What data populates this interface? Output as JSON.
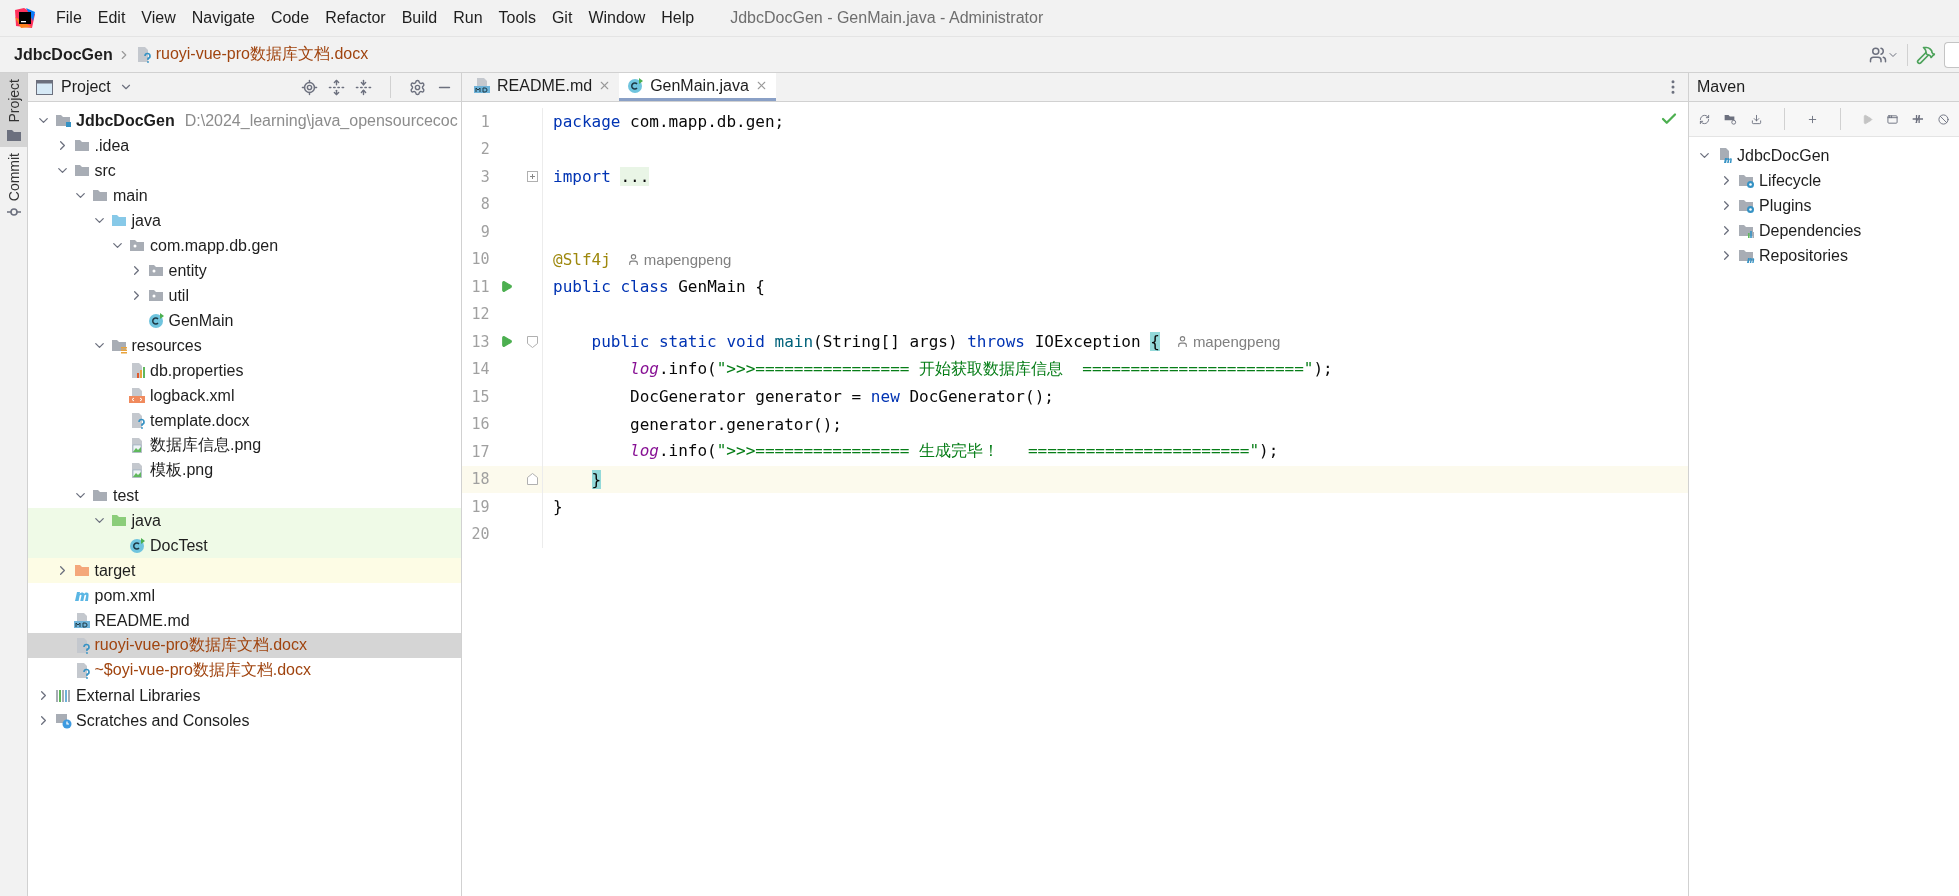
{
  "menu_bar": {
    "menus": [
      "File",
      "Edit",
      "View",
      "Navigate",
      "Code",
      "Refactor",
      "Build",
      "Run",
      "Tools",
      "Git",
      "Window",
      "Help"
    ],
    "title": "JdbcDocGen - GenMain.java - Administrator"
  },
  "breadcrumb": {
    "project": "JdbcDocGen",
    "file": "ruoyi-vue-pro数据库文档.docx"
  },
  "side_strip": {
    "tabs": [
      {
        "label": "Project",
        "selected": true
      },
      {
        "label": "Commit",
        "selected": false
      }
    ]
  },
  "project_panel": {
    "title": "Project",
    "tree": [
      {
        "label": "JdbcDocGen",
        "path": "D:\\2024_learning\\java_opensourcecoc",
        "kind": "module",
        "expanded": true,
        "selected": false,
        "children": [
          {
            "label": ".idea",
            "kind": "folder",
            "expanded": false,
            "selected": false
          },
          {
            "label": "src",
            "kind": "folder",
            "expanded": true,
            "selected": false,
            "children": [
              {
                "label": "main",
                "kind": "folder",
                "expanded": true,
                "selected": false,
                "children": [
                  {
                    "label": "java",
                    "kind": "source-folder",
                    "expanded": true,
                    "selected": false,
                    "children": [
                      {
                        "label": "com.mapp.db.gen",
                        "kind": "package",
                        "expanded": true,
                        "selected": false,
                        "children": [
                          {
                            "label": "entity",
                            "kind": "package",
                            "expanded": false,
                            "selected": false
                          },
                          {
                            "label": "util",
                            "kind": "package",
                            "expanded": false,
                            "selected": false
                          },
                          {
                            "label": "GenMain",
                            "kind": "class",
                            "selected": false
                          }
                        ]
                      }
                    ]
                  },
                  {
                    "label": "resources",
                    "kind": "resources",
                    "expanded": true,
                    "selected": false,
                    "children": [
                      {
                        "label": "db.properties",
                        "kind": "properties",
                        "selected": false
                      },
                      {
                        "label": "logback.xml",
                        "kind": "xml",
                        "selected": false
                      },
                      {
                        "label": "template.docx",
                        "kind": "doc",
                        "selected": false
                      },
                      {
                        "label": "数据库信息.png",
                        "kind": "image",
                        "selected": false
                      },
                      {
                        "label": "模板.png",
                        "kind": "image",
                        "selected": false
                      }
                    ]
                  }
                ]
              },
              {
                "label": "test",
                "kind": "folder",
                "expanded": true,
                "selected": false,
                "children": [
                  {
                    "label": "java",
                    "kind": "test-folder",
                    "expanded": true,
                    "selected": false,
                    "children": [
                      {
                        "label": "DocTest",
                        "kind": "test-class",
                        "selected": false
                      }
                    ]
                  }
                ]
              }
            ]
          },
          {
            "label": "target",
            "kind": "excluded-folder",
            "expanded": false,
            "selected": false
          },
          {
            "label": "pom.xml",
            "kind": "maven",
            "selected": false
          },
          {
            "label": "README.md",
            "kind": "markdown",
            "selected": false
          },
          {
            "label": "ruoyi-vue-pro数据库文档.docx",
            "kind": "unversioned-doc",
            "selected": true
          },
          {
            "label": "~$oyi-vue-pro数据库文档.docx",
            "kind": "unversioned-doc",
            "selected": false
          }
        ]
      },
      {
        "label": "External Libraries",
        "kind": "libraries",
        "expanded": false,
        "selected": false
      },
      {
        "label": "Scratches and Consoles",
        "kind": "scratches",
        "expanded": false,
        "selected": false
      }
    ]
  },
  "editor": {
    "tabs": [
      {
        "label": "README.md",
        "kind": "markdown",
        "selected": false
      },
      {
        "label": "GenMain.java",
        "kind": "class",
        "selected": true
      }
    ],
    "lines": [
      {
        "number": "1",
        "current": false,
        "run": false,
        "tokens": [
          {
            "kind": "keyword",
            "text": "package"
          },
          {
            "kind": "plain",
            "text": " com.mapp.db.gen;"
          }
        ]
      },
      {
        "number": "2",
        "current": false,
        "run": false
      },
      {
        "number": "3",
        "kind": "fold-collapsed",
        "current": false,
        "run": false,
        "tokens": [
          {
            "kind": "keyword",
            "text": "import "
          },
          {
            "kind": "folded",
            "text": "..."
          }
        ]
      },
      {
        "number": "8",
        "current": false,
        "run": false
      },
      {
        "number": "9",
        "current": false,
        "run": false
      },
      {
        "number": "10",
        "current": false,
        "run": false,
        "author": "mapengpeng",
        "tokens": [
          {
            "kind": "annotation",
            "text": "@Slf4j"
          }
        ]
      },
      {
        "number": "11",
        "current": false,
        "run": true,
        "tokens": [
          {
            "kind": "keyword",
            "text": "public class"
          },
          {
            "kind": "plain",
            "text": " GenMain {"
          }
        ],
        "children": [
          {
            "number": "12",
            "current": false,
            "run": false
          },
          {
            "number": "13",
            "kind": "fold-start",
            "current": false,
            "run": true,
            "author": "mapengpeng",
            "tokens": [
              {
                "kind": "keyword",
                "text": "public static void"
              },
              {
                "kind": "method",
                "text": " main"
              },
              {
                "kind": "plain",
                "text": "(String[] args) "
              },
              {
                "kind": "keyword",
                "text": "throws"
              },
              {
                "kind": "plain",
                "text": " IOException "
              },
              {
                "kind": "brace",
                "text": "{"
              }
            ],
            "children": [
              {
                "number": "14",
                "current": false,
                "run": false,
                "tokens": [
                  {
                    "kind": "field",
                    "text": "log"
                  },
                  {
                    "kind": "plain",
                    "text": ".info("
                  },
                  {
                    "kind": "string",
                    "text": "\">>>================ 开始获取数据库信息  =======================\""
                  },
                  {
                    "kind": "plain",
                    "text": ");"
                  }
                ]
              },
              {
                "number": "15",
                "current": false,
                "run": false,
                "tokens": [
                  {
                    "kind": "plain",
                    "text": "DocGenerator generator = "
                  },
                  {
                    "kind": "keyword",
                    "text": "new"
                  },
                  {
                    "kind": "plain",
                    "text": " DocGenerator();"
                  }
                ]
              },
              {
                "number": "16",
                "current": false,
                "run": false,
                "tokens": [
                  {
                    "kind": "plain",
                    "text": "generator.generator();"
                  }
                ]
              },
              {
                "number": "17",
                "current": false,
                "run": false,
                "tokens": [
                  {
                    "kind": "field",
                    "text": "log"
                  },
                  {
                    "kind": "plain",
                    "text": ".info("
                  },
                  {
                    "kind": "string",
                    "text": "\">>>================ 生成完毕！   =======================\""
                  },
                  {
                    "kind": "plain",
                    "text": ");"
                  }
                ]
              }
            ]
          },
          {
            "number": "18",
            "kind": "fold-end",
            "current": true,
            "run": false,
            "tokens": [
              {
                "kind": "brace",
                "text": "}"
              }
            ]
          }
        ]
      },
      {
        "number": "19",
        "current": false,
        "run": false,
        "tokens": [
          {
            "kind": "plain",
            "text": "}"
          }
        ]
      },
      {
        "number": "20",
        "current": false,
        "run": false
      }
    ]
  },
  "maven_panel": {
    "title": "Maven",
    "tree": [
      {
        "label": "JdbcDocGen",
        "kind": "maven-module",
        "expanded": true,
        "selected": false,
        "children": [
          {
            "label": "Lifecycle",
            "kind": "gear-folder",
            "expanded": false,
            "selected": false
          },
          {
            "label": "Plugins",
            "kind": "gear-folder",
            "expanded": false,
            "selected": false
          },
          {
            "label": "Dependencies",
            "kind": "bars-folder",
            "expanded": false,
            "selected": false
          },
          {
            "label": "Repositories",
            "kind": "m-folder",
            "expanded": false,
            "selected": false
          }
        ]
      }
    ]
  }
}
